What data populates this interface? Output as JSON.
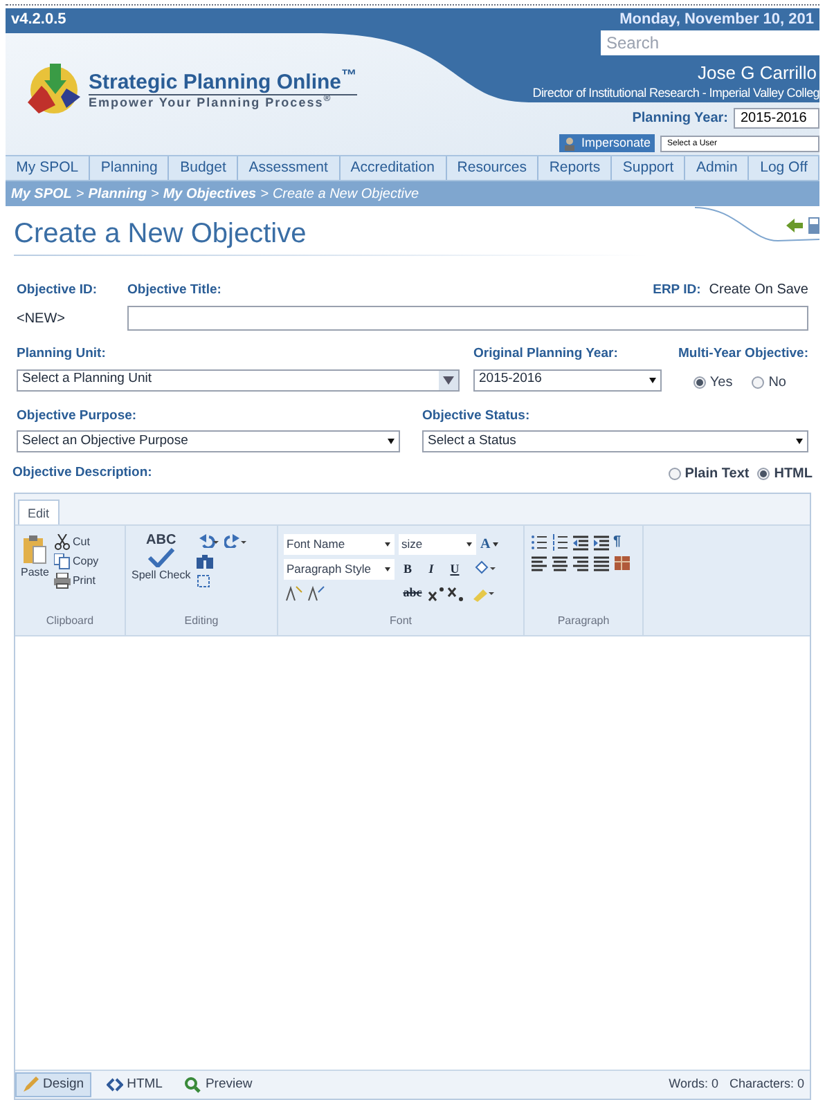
{
  "header": {
    "version": "v4.2.0.5",
    "date": "Monday, November 10, 201",
    "search": {
      "placeholder": "Search"
    },
    "user": "Jose G Carrillo",
    "user_title": "Director of Institutional Research - Imperial Valley Colleg",
    "planning_year_label": "Planning Year:",
    "planning_year": "2015-2016",
    "impersonate": "Impersonate",
    "user_select": "Select a User"
  },
  "logo": {
    "name": "Strategic Planning Online",
    "trademark": "™",
    "tagline": "Empower Your Planning Process",
    "registered": "®"
  },
  "nav": [
    {
      "label": "My SPOL",
      "selected": false
    },
    {
      "label": "Planning",
      "selected": false
    },
    {
      "label": "Budget",
      "selected": false
    },
    {
      "label": "Assessment",
      "selected": false
    },
    {
      "label": "Accreditation",
      "selected": false
    },
    {
      "label": "Resources",
      "selected": false
    },
    {
      "label": "Reports",
      "selected": false
    },
    {
      "label": "Support",
      "selected": false
    },
    {
      "label": "Admin",
      "selected": false
    },
    {
      "label": "Log Off",
      "selected": false
    }
  ],
  "breadcrumb": [
    {
      "label": "My SPOL",
      "kind": "link"
    },
    {
      "label": ">",
      "kind": "sep"
    },
    {
      "label": "Planning",
      "kind": "link"
    },
    {
      "label": ">",
      "kind": "sep"
    },
    {
      "label": "My Objectives",
      "kind": "link"
    },
    {
      "label": ">",
      "kind": "sep"
    },
    {
      "label": "Create a New Objective",
      "kind": "current"
    }
  ],
  "page_title": "Create a New Objective",
  "form": {
    "objective_id_label": "Objective ID:",
    "objective_id": "<NEW>",
    "title_label": "Objective Title:",
    "erp_label": "ERP ID:",
    "erp_value": "Create On Save",
    "planning_unit_label": "Planning Unit:",
    "planning_unit": "Select a Planning Unit",
    "year_label": "Original Planning Year:",
    "year": "2015-2016",
    "multi_year_label": "Multi-Year Objective:",
    "multi_year": [
      {
        "label": "Yes",
        "selected": true
      },
      {
        "label": "No",
        "selected": false
      }
    ],
    "purpose_label": "Objective Purpose:",
    "purpose": "Select an Objective Purpose",
    "status_label": "Objective Status:",
    "status": "Select a Status",
    "description_label": "Objective Description:",
    "format": [
      {
        "label": "Plain Text",
        "selected": false
      },
      {
        "label": "HTML",
        "selected": true
      }
    ]
  },
  "editor": {
    "tab": "Edit",
    "clipboard": {
      "paste": "Paste",
      "cut": "Cut",
      "copy": "Copy",
      "print": "Print",
      "group": "Clipboard"
    },
    "editing": {
      "spell": "Spell Check",
      "abc": "ABC",
      "group": "Editing"
    },
    "font": {
      "font_name": "Font Name",
      "size": "size",
      "paragraph_style": "Paragraph Style",
      "group": "Font",
      "bold": "B",
      "italic": "I",
      "underline": "U",
      "font_color_glyph": "A",
      "strike": "abc"
    },
    "paragraph": {
      "group": "Paragraph",
      "pilcrow": "¶"
    },
    "modes": [
      {
        "label": "Design",
        "selected": true
      },
      {
        "label": "HTML",
        "selected": false
      },
      {
        "label": "Preview",
        "selected": false
      }
    ],
    "words": "Words: 0",
    "characters": "Characters: 0"
  }
}
